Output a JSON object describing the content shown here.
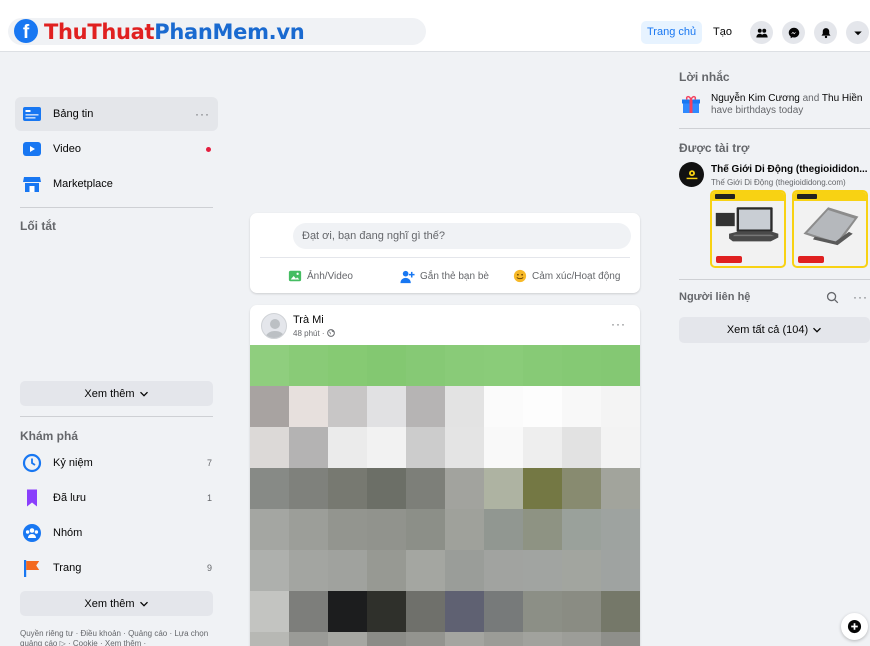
{
  "topbar": {
    "brand_part1": "ThuThuat",
    "brand_part2": "PhanMem.vn",
    "nav_home": "Trang chủ",
    "nav_create": "Tạo"
  },
  "left_nav": {
    "items": [
      {
        "label": "Bảng tin"
      },
      {
        "label": "Video"
      },
      {
        "label": "Marketplace"
      }
    ],
    "shortcuts_title": "Lối tắt",
    "see_more_1": "Xem thêm",
    "explore_title": "Khám phá",
    "explore_items": [
      {
        "label": "Kỷ niệm",
        "count": "7"
      },
      {
        "label": "Đã lưu",
        "count": "1"
      },
      {
        "label": "Nhóm",
        "count": ""
      },
      {
        "label": "Trang",
        "count": "9"
      }
    ],
    "see_more_2": "Xem thêm",
    "footer": "Quyền riêng tư · Điều khoản · Quảng cáo · Lựa chọn quảng cáo ▷ · Cookie · Xem thêm ·"
  },
  "composer": {
    "placeholder": "Đạt ơi, bạn đang nghĩ gì thế?",
    "photo_label": "Ảnh/Video",
    "tag_label": "Gắn thẻ bạn bè",
    "feeling_label": "Cảm xúc/Hoạt động"
  },
  "post": {
    "author": "Trà Mi",
    "time": "48 phút ·",
    "mosaic_colors": [
      [
        "#8fce7e",
        "#89cb77",
        "#86ca73",
        "#83c871",
        "#86c975",
        "#89cb78",
        "#8acc79",
        "#87ca76",
        "#85c974",
        "#84c873"
      ],
      [
        "#a8a3a1",
        "#e7e0dd",
        "#c8c6c6",
        "#e1e1e3",
        "#b6b4b4",
        "#e3e3e3",
        "#fbfbfb",
        "#fdfdfd",
        "#f8f8f8",
        "#f4f4f4"
      ],
      [
        "#dcd9d7",
        "#b4b3b3",
        "#ebebeb",
        "#f2f2f2",
        "#cccccc",
        "#e4e4e4",
        "#f9f9f9",
        "#eeeeee",
        "#e2e2e2",
        "#f3f3f3"
      ],
      [
        "#878a86",
        "#7f817c",
        "#777971",
        "#6c6f67",
        "#7d7f79",
        "#a2a39e",
        "#aeb3a2",
        "#747844",
        "#888b70",
        "#a2a49c"
      ],
      [
        "#a4a6a2",
        "#9c9e99",
        "#93958f",
        "#91938d",
        "#8c8f88",
        "#9fa19b",
        "#919791",
        "#8e9383",
        "#9aa19b",
        "#9ea3a0"
      ],
      [
        "#aeb0ad",
        "#a3a5a1",
        "#a0a29e",
        "#979993",
        "#a4a6a1",
        "#9a9d99",
        "#a1a3a0",
        "#a1a4a1",
        "#a2a59f",
        "#9fa3a1"
      ],
      [
        "#c3c4c1",
        "#7d7e7b",
        "#1c1d1e",
        "#2f302b",
        "#6f706b",
        "#5f6172",
        "#777a7a",
        "#8c8f86",
        "#8a8c83",
        "#757869"
      ],
      [
        "#b7b8b4",
        "#9a9b97",
        "#a6a7a2",
        "#8b8c87",
        "#93948f",
        "#a4a5a0",
        "#9b9c97",
        "#a1a29d",
        "#9c9d98",
        "#8e8f8a"
      ]
    ]
  },
  "right": {
    "reminders_title": "Lời nhắc",
    "bday_name1": "Nguyễn Kim Cương",
    "bday_and": " and ",
    "bday_name2": "Thu Hiền",
    "bday_suffix": "have birthdays today",
    "sponsored_title": "Được tài trợ",
    "sponsor_name": "Thế Giới Di Động (thegioididon...",
    "sponsor_url": "Thế Giới Di Động (thegioididong.com)",
    "contacts_title": "Người liên hệ",
    "see_all": "Xem tất cả (104)"
  },
  "colors": {
    "accent": "#1877f2",
    "brand_red": "#e02020",
    "brand_blue": "#1a6ad0",
    "ad_yellow": "#f8d213"
  }
}
